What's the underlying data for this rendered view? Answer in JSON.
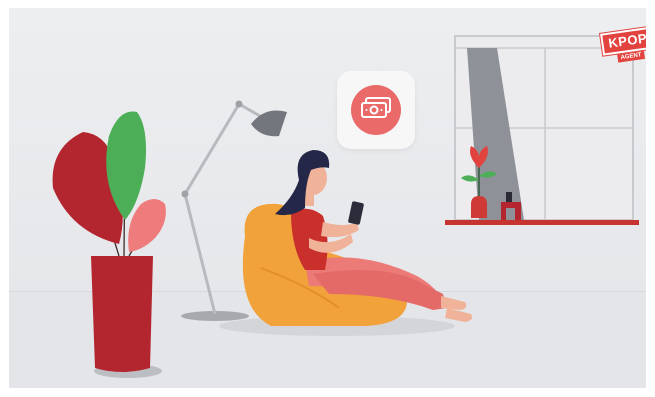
{
  "scene": {
    "logo": {
      "main_text": "KPOP",
      "sub_text": "AGENT"
    },
    "app_icon": "banknote-icon",
    "colors": {
      "brand_red": "#e2433f",
      "plant_dark_red": "#b3262f",
      "plant_green": "#4cae56",
      "plant_pink": "#ef7c7c",
      "beanbag_orange": "#f2a23a",
      "outfit_pink": "#ec7a77",
      "hair": "#242747",
      "app_tile_circle": "#ea6a6a"
    }
  }
}
